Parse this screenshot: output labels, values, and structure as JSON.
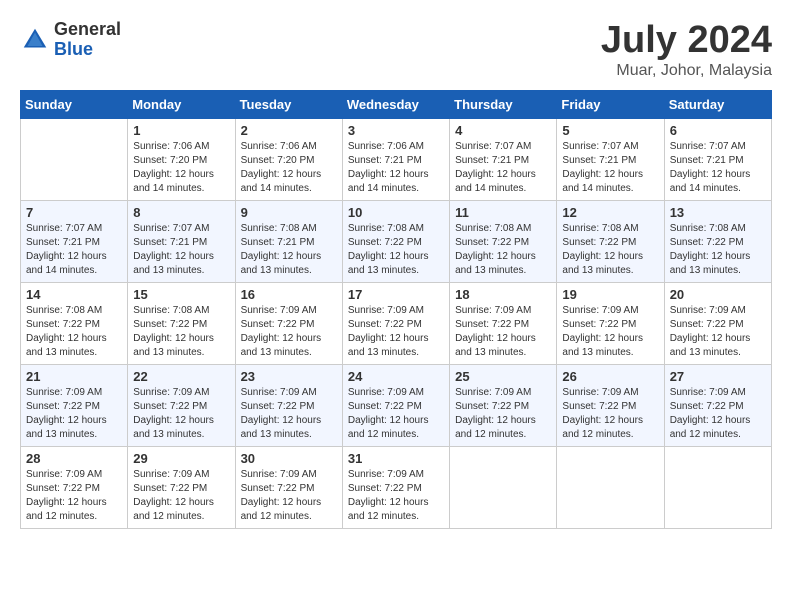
{
  "logo": {
    "general": "General",
    "blue": "Blue"
  },
  "title": {
    "month_year": "July 2024",
    "location": "Muar, Johor, Malaysia"
  },
  "days_of_week": [
    "Sunday",
    "Monday",
    "Tuesday",
    "Wednesday",
    "Thursday",
    "Friday",
    "Saturday"
  ],
  "weeks": [
    [
      {
        "day": "",
        "sunrise": "",
        "sunset": "",
        "daylight": ""
      },
      {
        "day": "1",
        "sunrise": "Sunrise: 7:06 AM",
        "sunset": "Sunset: 7:20 PM",
        "daylight": "Daylight: 12 hours and 14 minutes."
      },
      {
        "day": "2",
        "sunrise": "Sunrise: 7:06 AM",
        "sunset": "Sunset: 7:20 PM",
        "daylight": "Daylight: 12 hours and 14 minutes."
      },
      {
        "day": "3",
        "sunrise": "Sunrise: 7:06 AM",
        "sunset": "Sunset: 7:21 PM",
        "daylight": "Daylight: 12 hours and 14 minutes."
      },
      {
        "day": "4",
        "sunrise": "Sunrise: 7:07 AM",
        "sunset": "Sunset: 7:21 PM",
        "daylight": "Daylight: 12 hours and 14 minutes."
      },
      {
        "day": "5",
        "sunrise": "Sunrise: 7:07 AM",
        "sunset": "Sunset: 7:21 PM",
        "daylight": "Daylight: 12 hours and 14 minutes."
      },
      {
        "day": "6",
        "sunrise": "Sunrise: 7:07 AM",
        "sunset": "Sunset: 7:21 PM",
        "daylight": "Daylight: 12 hours and 14 minutes."
      }
    ],
    [
      {
        "day": "7",
        "sunrise": "Sunrise: 7:07 AM",
        "sunset": "Sunset: 7:21 PM",
        "daylight": "Daylight: 12 hours and 14 minutes."
      },
      {
        "day": "8",
        "sunrise": "Sunrise: 7:07 AM",
        "sunset": "Sunset: 7:21 PM",
        "daylight": "Daylight: 12 hours and 13 minutes."
      },
      {
        "day": "9",
        "sunrise": "Sunrise: 7:08 AM",
        "sunset": "Sunset: 7:21 PM",
        "daylight": "Daylight: 12 hours and 13 minutes."
      },
      {
        "day": "10",
        "sunrise": "Sunrise: 7:08 AM",
        "sunset": "Sunset: 7:22 PM",
        "daylight": "Daylight: 12 hours and 13 minutes."
      },
      {
        "day": "11",
        "sunrise": "Sunrise: 7:08 AM",
        "sunset": "Sunset: 7:22 PM",
        "daylight": "Daylight: 12 hours and 13 minutes."
      },
      {
        "day": "12",
        "sunrise": "Sunrise: 7:08 AM",
        "sunset": "Sunset: 7:22 PM",
        "daylight": "Daylight: 12 hours and 13 minutes."
      },
      {
        "day": "13",
        "sunrise": "Sunrise: 7:08 AM",
        "sunset": "Sunset: 7:22 PM",
        "daylight": "Daylight: 12 hours and 13 minutes."
      }
    ],
    [
      {
        "day": "14",
        "sunrise": "Sunrise: 7:08 AM",
        "sunset": "Sunset: 7:22 PM",
        "daylight": "Daylight: 12 hours and 13 minutes."
      },
      {
        "day": "15",
        "sunrise": "Sunrise: 7:08 AM",
        "sunset": "Sunset: 7:22 PM",
        "daylight": "Daylight: 12 hours and 13 minutes."
      },
      {
        "day": "16",
        "sunrise": "Sunrise: 7:09 AM",
        "sunset": "Sunset: 7:22 PM",
        "daylight": "Daylight: 12 hours and 13 minutes."
      },
      {
        "day": "17",
        "sunrise": "Sunrise: 7:09 AM",
        "sunset": "Sunset: 7:22 PM",
        "daylight": "Daylight: 12 hours and 13 minutes."
      },
      {
        "day": "18",
        "sunrise": "Sunrise: 7:09 AM",
        "sunset": "Sunset: 7:22 PM",
        "daylight": "Daylight: 12 hours and 13 minutes."
      },
      {
        "day": "19",
        "sunrise": "Sunrise: 7:09 AM",
        "sunset": "Sunset: 7:22 PM",
        "daylight": "Daylight: 12 hours and 13 minutes."
      },
      {
        "day": "20",
        "sunrise": "Sunrise: 7:09 AM",
        "sunset": "Sunset: 7:22 PM",
        "daylight": "Daylight: 12 hours and 13 minutes."
      }
    ],
    [
      {
        "day": "21",
        "sunrise": "Sunrise: 7:09 AM",
        "sunset": "Sunset: 7:22 PM",
        "daylight": "Daylight: 12 hours and 13 minutes."
      },
      {
        "day": "22",
        "sunrise": "Sunrise: 7:09 AM",
        "sunset": "Sunset: 7:22 PM",
        "daylight": "Daylight: 12 hours and 13 minutes."
      },
      {
        "day": "23",
        "sunrise": "Sunrise: 7:09 AM",
        "sunset": "Sunset: 7:22 PM",
        "daylight": "Daylight: 12 hours and 13 minutes."
      },
      {
        "day": "24",
        "sunrise": "Sunrise: 7:09 AM",
        "sunset": "Sunset: 7:22 PM",
        "daylight": "Daylight: 12 hours and 12 minutes."
      },
      {
        "day": "25",
        "sunrise": "Sunrise: 7:09 AM",
        "sunset": "Sunset: 7:22 PM",
        "daylight": "Daylight: 12 hours and 12 minutes."
      },
      {
        "day": "26",
        "sunrise": "Sunrise: 7:09 AM",
        "sunset": "Sunset: 7:22 PM",
        "daylight": "Daylight: 12 hours and 12 minutes."
      },
      {
        "day": "27",
        "sunrise": "Sunrise: 7:09 AM",
        "sunset": "Sunset: 7:22 PM",
        "daylight": "Daylight: 12 hours and 12 minutes."
      }
    ],
    [
      {
        "day": "28",
        "sunrise": "Sunrise: 7:09 AM",
        "sunset": "Sunset: 7:22 PM",
        "daylight": "Daylight: 12 hours and 12 minutes."
      },
      {
        "day": "29",
        "sunrise": "Sunrise: 7:09 AM",
        "sunset": "Sunset: 7:22 PM",
        "daylight": "Daylight: 12 hours and 12 minutes."
      },
      {
        "day": "30",
        "sunrise": "Sunrise: 7:09 AM",
        "sunset": "Sunset: 7:22 PM",
        "daylight": "Daylight: 12 hours and 12 minutes."
      },
      {
        "day": "31",
        "sunrise": "Sunrise: 7:09 AM",
        "sunset": "Sunset: 7:22 PM",
        "daylight": "Daylight: 12 hours and 12 minutes."
      },
      {
        "day": "",
        "sunrise": "",
        "sunset": "",
        "daylight": ""
      },
      {
        "day": "",
        "sunrise": "",
        "sunset": "",
        "daylight": ""
      },
      {
        "day": "",
        "sunrise": "",
        "sunset": "",
        "daylight": ""
      }
    ]
  ]
}
